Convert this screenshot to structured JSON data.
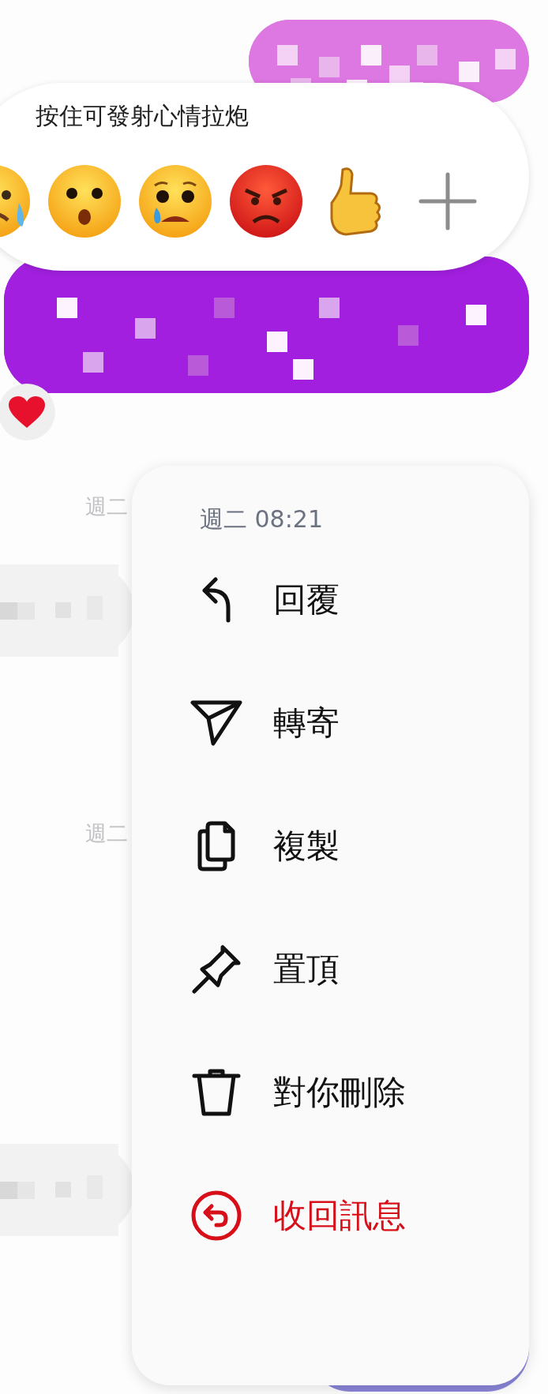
{
  "reaction_bar": {
    "hint": "按住可發射心情拉炮",
    "reactions": [
      {
        "kind": "crying"
      },
      {
        "kind": "surprised"
      },
      {
        "kind": "sad"
      },
      {
        "kind": "angry"
      },
      {
        "kind": "thumbs_up"
      },
      {
        "kind": "more"
      }
    ]
  },
  "messages": [
    {
      "kind": "outgoing_pink"
    },
    {
      "kind": "outgoing_purple",
      "reaction": {
        "kind": "heart"
      }
    },
    {
      "kind": "timestamp",
      "text": "週二"
    },
    {
      "kind": "incoming"
    },
    {
      "kind": "timestamp",
      "text": "週二"
    },
    {
      "kind": "incoming"
    }
  ],
  "context_menu": {
    "timestamp": "週二 08:21",
    "items": [
      {
        "kind": "reply",
        "label": "回覆",
        "danger": false
      },
      {
        "kind": "forward",
        "label": "轉寄",
        "danger": false
      },
      {
        "kind": "copy",
        "label": "複製",
        "danger": false
      },
      {
        "kind": "pin",
        "label": "置頂",
        "danger": false
      },
      {
        "kind": "delete",
        "label": "對你刪除",
        "danger": false
      },
      {
        "kind": "unsend",
        "label": "收回訊息",
        "danger": true
      }
    ]
  }
}
